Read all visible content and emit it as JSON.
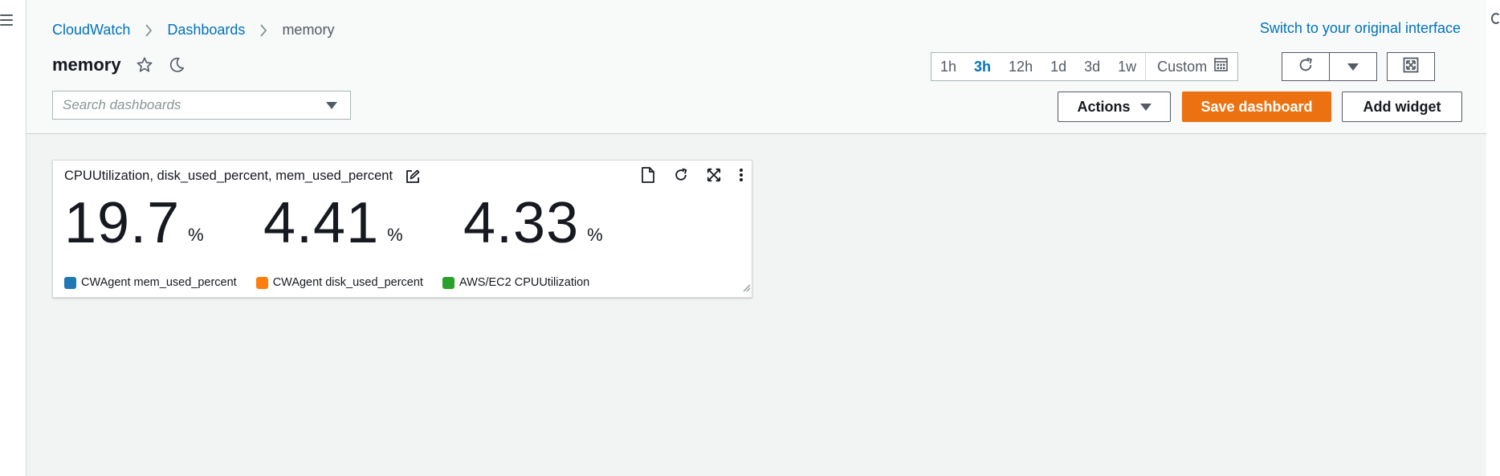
{
  "breadcrumbs": [
    {
      "label": "CloudWatch"
    },
    {
      "label": "Dashboards"
    },
    {
      "label": "memory"
    }
  ],
  "switch_link": "Switch to your original interface",
  "page_title": "memory",
  "search": {
    "placeholder": "Search dashboards"
  },
  "time_ranges": [
    {
      "label": "1h",
      "active": false
    },
    {
      "label": "3h",
      "active": true
    },
    {
      "label": "12h",
      "active": false
    },
    {
      "label": "1d",
      "active": false
    },
    {
      "label": "3d",
      "active": false
    },
    {
      "label": "1w",
      "active": false
    }
  ],
  "custom_label": "Custom",
  "buttons": {
    "actions": "Actions",
    "save": "Save dashboard",
    "add_widget": "Add widget"
  },
  "widget": {
    "title": "CPUUtilization, disk_used_percent, mem_used_percent",
    "metrics": [
      {
        "value": "19.7",
        "unit": "%"
      },
      {
        "value": "4.41",
        "unit": "%"
      },
      {
        "value": "4.33",
        "unit": "%"
      }
    ],
    "legend": [
      {
        "label": "CWAgent mem_used_percent",
        "color": "#1f77b4"
      },
      {
        "label": "CWAgent disk_used_percent",
        "color": "#ff7f0e"
      },
      {
        "label": "AWS/EC2 CPUUtilization",
        "color": "#2ca02c"
      }
    ]
  },
  "colors": {
    "link": "#0073bb",
    "primary_button": "#ec7211",
    "canvas_bg": "#f2f3f3"
  }
}
